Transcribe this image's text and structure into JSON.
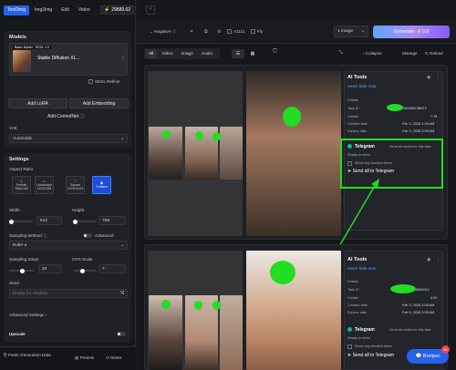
{
  "tabs": [
    "Text2img",
    "Img2img",
    "Edit",
    "Video"
  ],
  "credits": "29889.62",
  "models": {
    "title": "Models",
    "badge_base": "Basic Model",
    "badge_ver": "SDXL 1.0",
    "model_name": "Stable Diffusion XL...",
    "refiner_label": "SDXL Refiner",
    "add_lora": "Add LoRA",
    "add_embedding": "Add Embedding",
    "add_controlnet": "Add ControlNet",
    "vae_label": "VAE",
    "vae_value": "Automatic"
  },
  "settings": {
    "title": "Settings",
    "aspect_label": "Aspect Ratio",
    "ratios": [
      {
        "name": "Portrait",
        "size": "768x1152"
      },
      {
        "name": "Landscape",
        "size": "1152x768"
      },
      {
        "name": "Square",
        "size": "1024x1024"
      },
      {
        "name": "Custom",
        "size": ""
      }
    ],
    "width_label": "Width",
    "width_value": "512",
    "height_label": "Height",
    "height_value": "768",
    "sampling_method_label": "Sampling Method",
    "advanced_label": "Advanced",
    "sampler_value": "Euler a",
    "steps_label": "Sampling Steps",
    "steps_value": "20",
    "cfg_label": "CFG Scale",
    "cfg_value": "7",
    "seed_label": "Seed",
    "seed_placeholder": "Empty for random",
    "advanced_settings": "Advanced Settings",
    "upscale_label": "Upscale"
  },
  "footer": {
    "paste": "Paste Generation Data",
    "presets": "Presets",
    "reset": "Reset"
  },
  "top": {
    "negative": "Negative",
    "a1111": "A1111",
    "flx": "Flx",
    "images_value": "1 image",
    "generate": "Generate",
    "generate_cost": "0.8"
  },
  "filters": {
    "items": [
      "All",
      "Video",
      "Image",
      "Audio"
    ],
    "collapse": "Collapse",
    "manage": "Manage",
    "reload": "Reload"
  },
  "cards": [
    {
      "tool_title": "AI Tools",
      "tool_link": "never hide now",
      "details_label": "Details",
      "task_id_label": "Task ID",
      "task_id_value": "06235673B012",
      "credits_label": "Credits",
      "credits_value": "7.78",
      "created_label": "Created date",
      "created_value": "Feb 3, 2026 1:09 AM",
      "expires_label": "Expires date",
      "expires_value": "Feb 3, 2026 2:59 AM",
      "telegram_title": "Telegram",
      "telegram_hint": "Send all media for this task",
      "ready": "Ready to send.",
      "blocked": "Send only blocked items",
      "send_all": "Send all to Telegram"
    },
    {
      "tool_title": "AI Tools",
      "tool_link": "never hide now",
      "details_label": "Details",
      "task_id_label": "Task ID",
      "task_id_value": "5b80012",
      "credits_label": "Credits",
      "credits_value": "4.00",
      "created_label": "Created date",
      "created_value": "Feb 3, 2026 1:08 AM",
      "expires_label": "Expires date",
      "expires_value": "Feb 3, 2026 2:59 AM",
      "telegram_title": "Telegram",
      "telegram_hint": "Send all media for this task",
      "ready": "Ready to send.",
      "blocked": "Send only blocked items",
      "send_all": "Send all to Telegram"
    }
  ],
  "chat": {
    "label": "Вопрос",
    "badge": "26"
  },
  "colors": {
    "accent": "#2563eb",
    "highlight": "#22dd22",
    "panel": "#23252b"
  }
}
